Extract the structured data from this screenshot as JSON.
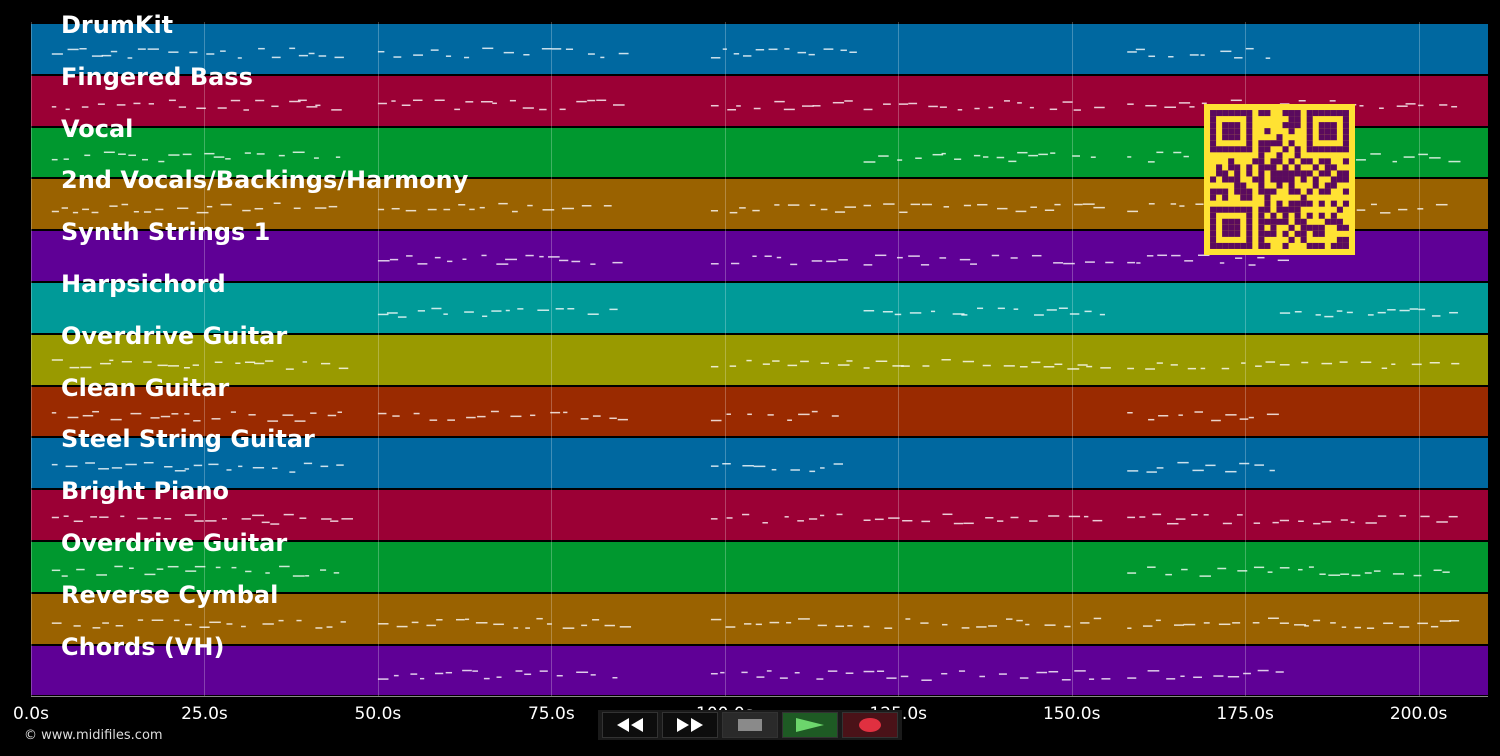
{
  "tracks": [
    {
      "name": "DrumKit",
      "color": "#0068a0"
    },
    {
      "name": "Fingered Bass",
      "color": "#9b0035"
    },
    {
      "name": "Vocal",
      "color": "#00982f"
    },
    {
      "name": "2nd Vocals/Backings/Harmony",
      "color": "#9a6200"
    },
    {
      "name": "Synth Strings 1",
      "color": "#5f0096"
    },
    {
      "name": "Harpsichord",
      "color": "#009a98"
    },
    {
      "name": "Overdrive Guitar",
      "color": "#999a00"
    },
    {
      "name": "Clean Guitar",
      "color": "#9a2a00"
    },
    {
      "name": "Steel String Guitar",
      "color": "#0068a0"
    },
    {
      "name": "Bright Piano",
      "color": "#9b0035"
    },
    {
      "name": "Overdrive Guitar",
      "color": "#00982f"
    },
    {
      "name": "Reverse Cymbal",
      "color": "#9a6200"
    },
    {
      "name": "Chords (VH)",
      "color": "#5f0096"
    }
  ],
  "timeline": {
    "ticks": [
      "0.0s",
      "25.0s",
      "50.0s",
      "75.0s",
      "100.0s",
      "125.0s",
      "150.0s",
      "175.0s",
      "200.0s"
    ],
    "max_seconds": 210
  },
  "transport": {
    "rewind_icon": "rewind-icon",
    "fastforward_icon": "fast-forward-icon",
    "stop_icon": "stop-icon",
    "play_icon": "play-icon",
    "record_icon": "record-icon"
  },
  "copyright": "© www.midifiles.com",
  "qr_icon": "qr-code-icon"
}
